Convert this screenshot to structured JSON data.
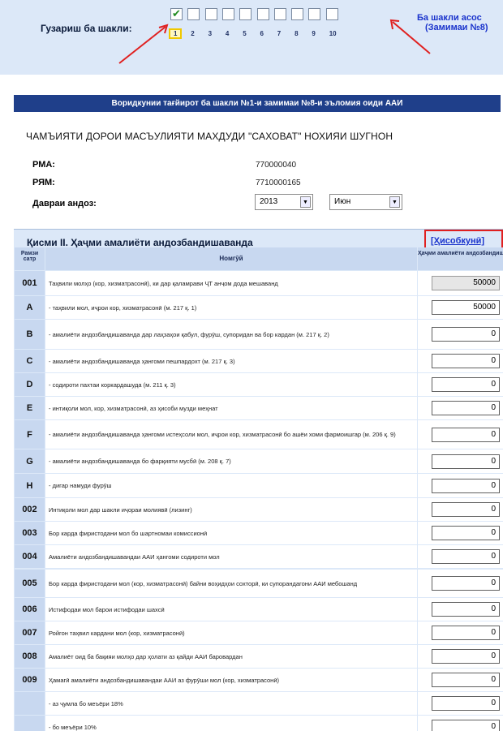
{
  "nav": {
    "label": "Гузариш ба шакли:",
    "pages": [
      "1",
      "2",
      "3",
      "4",
      "5",
      "6",
      "7",
      "8",
      "9",
      "10"
    ],
    "active_page": "1",
    "link_line1": "Ба шакли асос",
    "link_line2": "(Замимаи №8)"
  },
  "header_bar": "Воридкунии тағйирот ба шакли №1-и замимаи №8-и эъломия оиди ААИ",
  "company": "ЧАМЪИЯТИ ДОРОИ МАСЪУЛИЯТИ МАХДУДИ \"САХОВАТ\" НОХИЯИ ШУГНОН",
  "info": {
    "rma_label": "РМА:",
    "rma_value": "770000040",
    "rya_label": "РЯМ:",
    "rya_value": "7710000165",
    "period_label": "Даврaи андоз:",
    "year": "2013",
    "month": "Июн"
  },
  "section": {
    "title": "Қисми II. Ҳаҷми амалиёти андозбандишаванда",
    "calc_button": "[Ҳисобкунӣ]",
    "col_code": "Рамзи сатр",
    "col_name": "Номгӯй",
    "col_value": "Ҳаҷми амалиёти андозбандишаванда"
  },
  "rows": [
    {
      "code": "001",
      "name": "Таҳвили молҳо (кор, хизматрасонӣ), ки дар қаламрави ҶТ анҷом дода мешаванд",
      "value": "50000",
      "readonly": true
    },
    {
      "code": "A",
      "name": "- таҳвили мол, иҷрои кор, хизматрасонӣ (м. 217 қ. 1)",
      "value": "50000"
    },
    {
      "code": "B",
      "name": "- амалиёти андозбандишаванда дар лаҳзаҳои қабул, фурӯш, супоридан ва бор кардан (м. 217 қ. 2)",
      "value": "0"
    },
    {
      "code": "C",
      "name": "- амалиёти андозбандишаванда ҳангоми пешпардохт (м. 217 қ. 3)",
      "value": "0"
    },
    {
      "code": "D",
      "name": "- содироти пахтаи коркардашуда (м. 211 қ. 3)",
      "value": "0"
    },
    {
      "code": "E",
      "name": "- интиқоли мол, кор, хизматрасонӣ, аз ҳисоби музди меҳнат",
      "value": "0"
    },
    {
      "code": "F",
      "name": "- амалиёти андозбандишаванда ҳангоми истеҳсоли мол, иҷрои кор, хизматрасонӣ бо ашёи хоми фармоишгар (м. 206 қ. 9)",
      "value": "0"
    },
    {
      "code": "G",
      "name": "- амалиёти андозбандишаванда бо фарқияти мусбӣ (м. 208 қ. 7)",
      "value": "0"
    },
    {
      "code": "H",
      "name": "- дигар намуди фурӯш",
      "value": "0"
    },
    {
      "code": "002",
      "name": "Интиқоли мол дар шакли иҷораи молиявӣ (лизинг)",
      "value": "0"
    },
    {
      "code": "003",
      "name": "Бор карда фиристодани мол бо шартномаи комиссионӣ",
      "value": "0"
    },
    {
      "code": "004",
      "name": "Амалиёти андозбандишавандаи ААИ ҳангоми содироти мол",
      "value": "0"
    },
    {
      "code": "005",
      "name": "Бор карда фиристодани мол (кор, хизматрасонӣ) байни воҳидҳои сохторӣ, ки супорандагони ААИ мебошанд",
      "value": "0"
    },
    {
      "code": "006",
      "name": "Истифодаи мол барои истифодаи шахсӣ",
      "value": "0"
    },
    {
      "code": "007",
      "name": "Ройгон таҳвил кардани мол (кор, хизматрасонӣ)",
      "value": "0"
    },
    {
      "code": "008",
      "name": "Амалиёт оид ба бақияи молҳо дар ҳолати аз қайди ААИ баровардан",
      "value": "0"
    },
    {
      "code": "009",
      "name": "Ҳамагӣ амалиёти андозбандишавандаи ААИ аз фурӯши мол (кор, хизматрасонӣ)",
      "value": "0"
    },
    {
      "code": "",
      "name": "- аз ҷумла бо меъёри 18%",
      "value": "0"
    },
    {
      "code": "",
      "name": "- бо меъёри 10%",
      "value": "0"
    }
  ]
}
